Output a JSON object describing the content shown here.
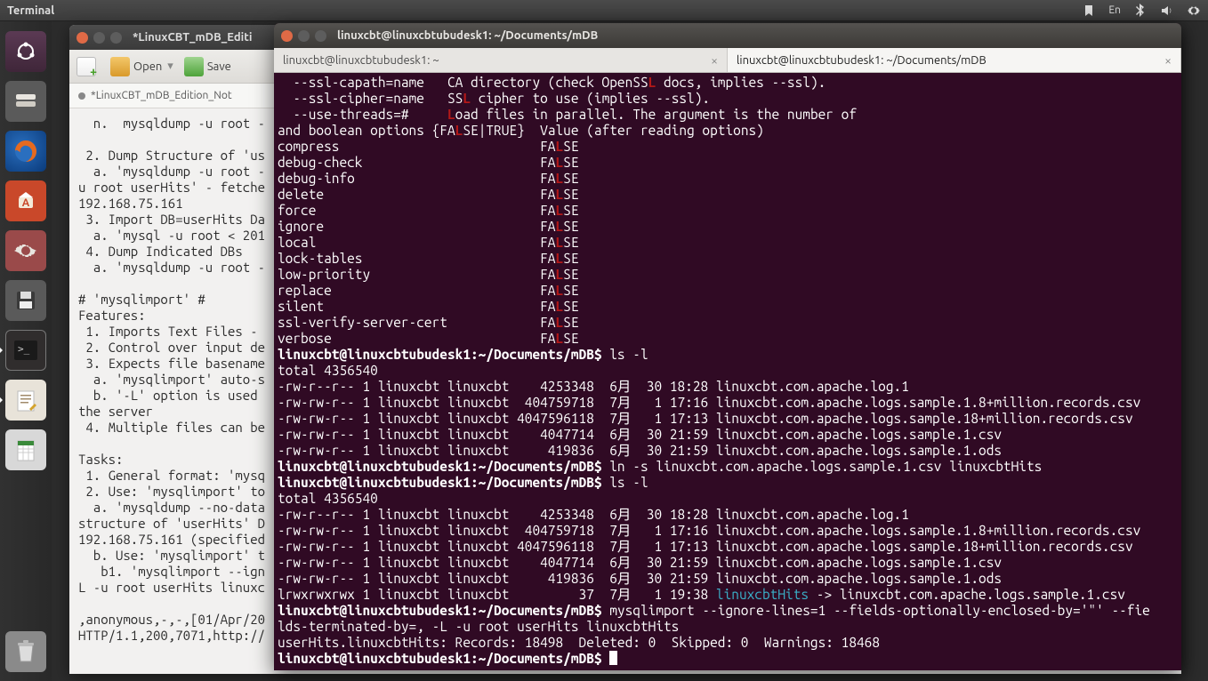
{
  "top_panel": {
    "title": "Terminal",
    "indicators": {
      "network": "net",
      "lang": "En",
      "bluetooth": "bt",
      "sound": "snd",
      "gear": "gear"
    }
  },
  "launcher": {
    "items": [
      {
        "name": "dash",
        "label": "Dash"
      },
      {
        "name": "files",
        "label": "Files"
      },
      {
        "name": "firefox",
        "label": "Firefox"
      },
      {
        "name": "software",
        "label": "Ubuntu Software"
      },
      {
        "name": "settings",
        "label": "Settings"
      },
      {
        "name": "saved",
        "label": "Save"
      },
      {
        "name": "terminal",
        "label": "Terminal"
      },
      {
        "name": "editor",
        "label": "Text Editor"
      },
      {
        "name": "calc",
        "label": "LibreOffice Calc"
      }
    ],
    "trash": "Trash"
  },
  "editor": {
    "window_title": "*LinuxCBT_mDB_Editi",
    "toolbar": {
      "open": "Open",
      "save": "Save",
      "dropdown": "▾"
    },
    "tab": "*LinuxCBT_mDB_Edition_Not",
    "content": "  n.  mysqldump -u root -\n\n 2. Dump Structure of 'us\n  a. 'mysqldump -u root -\nu root userHits' - fetche\n192.168.75.161\n 3. Import DB=userHits Da\n  a. 'mysql -u root < 201\n 4. Dump Indicated DBs\n  a. 'mysqldump -u root -\n\n# 'mysqlimport' #\nFeatures:\n 1. Imports Text Files -\n 2. Control over input de\n 3. Expects file basename\n  a. 'mysqlimport' auto-s\n  b. '-L' option is used\nthe server\n 4. Multiple files can be\n\nTasks:\n 1. General format: 'mysq\n 2. Use: 'mysqlimport' to\n  a. 'mysqldump --no-data\nstructure of 'userHits' D\n192.168.75.161 (specified\n  b. Use: 'mysqlimport' t\n   b1. 'mysqlimport --ign\nL -u root userHits linuxc\n\n,anonymous,-,-,[01/Apr/20\nHTTP/1.1,200,7071,http://"
  },
  "terminal": {
    "window_title": "linuxcbt@linuxcbtubudesk1: ~/Documents/mDB",
    "tabs": [
      {
        "label": "linuxcbt@linuxcbtubudesk1: ~",
        "active": false
      },
      {
        "label": "linuxcbt@linuxcbtubudesk1: ~/Documents/mDB",
        "active": true
      }
    ],
    "options_header": [
      "  --ssl-capath=name   CA directory (check OpenSSL docs, implies --ssl).",
      "  --ssl-cipher=name   SSL cipher to use (implies --ssl).",
      "  --use-threads=#     Load files in parallel. The argument is the number of",
      "and boolean options {FALSE|TRUE}  Value (after reading options)"
    ],
    "options": [
      {
        "k": "compress",
        "v": "FALSE"
      },
      {
        "k": "debug-check",
        "v": "FALSE"
      },
      {
        "k": "debug-info",
        "v": "FALSE"
      },
      {
        "k": "delete",
        "v": "FALSE"
      },
      {
        "k": "force",
        "v": "FALSE"
      },
      {
        "k": "ignore",
        "v": "FALSE"
      },
      {
        "k": "local",
        "v": "FALSE"
      },
      {
        "k": "lock-tables",
        "v": "FALSE"
      },
      {
        "k": "low-priority",
        "v": "FALSE"
      },
      {
        "k": "replace",
        "v": "FALSE"
      },
      {
        "k": "silent",
        "v": "FALSE"
      },
      {
        "k": "ssl-verify-server-cert",
        "v": "FALSE"
      },
      {
        "k": "verbose",
        "v": "FALSE"
      }
    ],
    "prompt": "linuxcbt@linuxcbtubudesk1:~/Documents/mDB$",
    "cmd_ls1": "ls -l",
    "total1": "total 4356540",
    "listing1": [
      "-rw-r--r-- 1 linuxcbt linuxcbt    4253348  6月  30 18:28 linuxcbt.com.apache.log.1",
      "-rw-rw-r-- 1 linuxcbt linuxcbt  404759718  7月   1 17:16 linuxcbt.com.apache.logs.sample.1.8+million.records.csv",
      "-rw-rw-r-- 1 linuxcbt linuxcbt 4047596118  7月   1 17:13 linuxcbt.com.apache.logs.sample.18+million.records.csv",
      "-rw-rw-r-- 1 linuxcbt linuxcbt    4047714  6月  30 21:59 linuxcbt.com.apache.logs.sample.1.csv",
      "-rw-rw-r-- 1 linuxcbt linuxcbt     419836  6月  30 21:59 linuxcbt.com.apache.logs.sample.1.ods"
    ],
    "cmd_ln": "ln -s linuxcbt.com.apache.logs.sample.1.csv linuxcbtHits",
    "cmd_ls2": "ls -l",
    "total2": "total 4356540",
    "listing2": [
      "-rw-r--r-- 1 linuxcbt linuxcbt    4253348  6月  30 18:28 linuxcbt.com.apache.log.1",
      "-rw-rw-r-- 1 linuxcbt linuxcbt  404759718  7月   1 17:16 linuxcbt.com.apache.logs.sample.1.8+million.records.csv",
      "-rw-rw-r-- 1 linuxcbt linuxcbt 4047596118  7月   1 17:13 linuxcbt.com.apache.logs.sample.18+million.records.csv",
      "-rw-rw-r-- 1 linuxcbt linuxcbt    4047714  6月  30 21:59 linuxcbt.com.apache.logs.sample.1.csv",
      "-rw-rw-r-- 1 linuxcbt linuxcbt     419836  6月  30 21:59 linuxcbt.com.apache.logs.sample.1.ods"
    ],
    "symlink_line_pre": "lrwxrwxrwx 1 linuxcbt linuxcbt         37  7月   1 19:38 ",
    "symlink_name": "linuxcbtHits",
    "symlink_arrow": " -> linuxcbt.com.apache.logs.sample.1.csv",
    "cmd_import_l1": "mysqlimport --ignore-lines=1 --fields-optionally-enclosed-by='\"' --fie",
    "cmd_import_l2": "lds-terminated-by=, -L -u root userHits linuxcbtHits",
    "result": "userHits.linuxcbtHits: Records: 18498  Deleted: 0  Skipped: 0  Warnings: 18468"
  }
}
